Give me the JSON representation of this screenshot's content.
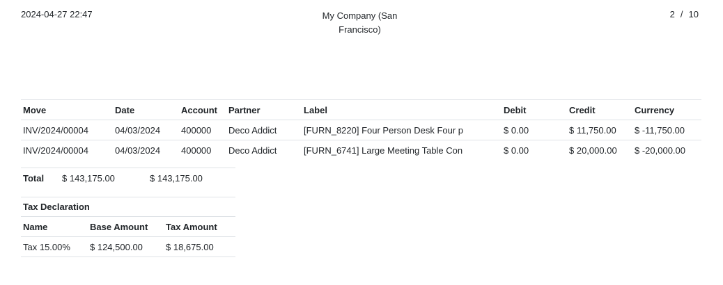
{
  "header": {
    "datetime": "2024-04-27 22:47",
    "company": "My Company (San Francisco)",
    "page_current": "2",
    "page_separator": "/",
    "page_total": "10"
  },
  "lines_table": {
    "columns": [
      "Move",
      "Date",
      "Account",
      "Partner",
      "Label",
      "Debit",
      "Credit",
      "Currency"
    ],
    "rows": [
      [
        "INV/2024/00004",
        "04/03/2024",
        "400000",
        "Deco Addict",
        "[FURN_8220] Four Person Desk Four p",
        "$ 0.00",
        "$ 11,750.00",
        "$ -11,750.00"
      ],
      [
        "INV/2024/00004",
        "04/03/2024",
        "400000",
        "Deco Addict",
        "[FURN_6741] Large Meeting Table Con",
        "$ 0.00",
        "$ 20,000.00",
        "$ -20,000.00"
      ]
    ]
  },
  "totals": {
    "label": "Total",
    "debit": "$ 143,175.00",
    "credit": "$ 143,175.00"
  },
  "tax_declaration": {
    "title": "Tax Declaration",
    "columns": [
      "Name",
      "Base Amount",
      "Tax Amount"
    ],
    "rows": [
      [
        "Tax 15.00%",
        "$ 124,500.00",
        "$ 18,675.00"
      ]
    ]
  }
}
